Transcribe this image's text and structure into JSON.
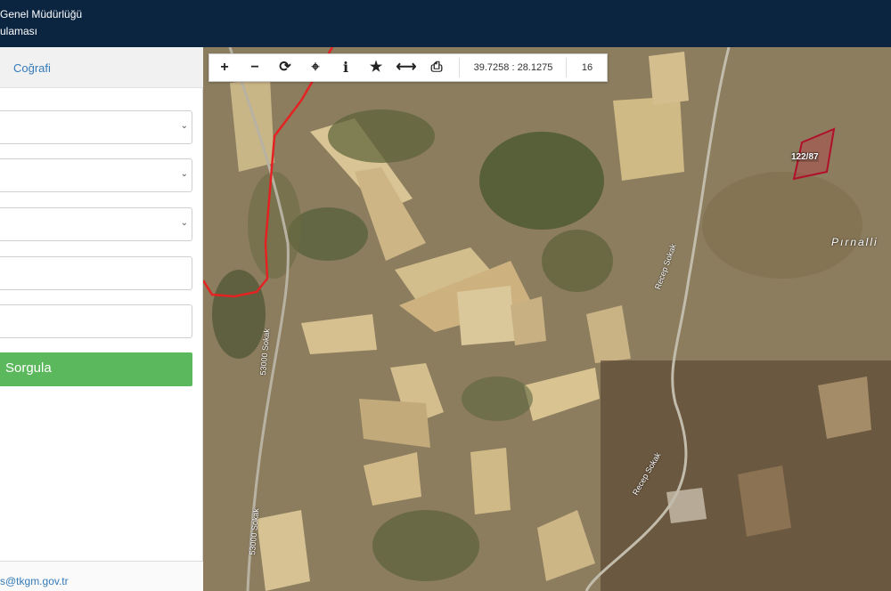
{
  "header": {
    "title_line1": "Genel Müdürlüğü",
    "title_line2": "ulaması"
  },
  "sidebar": {
    "tab_label": "Coğrafi",
    "query_button": "Sorgula",
    "footer_email": "s@tkgm.gov.tr"
  },
  "toolbar": {
    "zoom_in": "+",
    "zoom_out": "−",
    "refresh": "⟳",
    "locate": "⌖",
    "info": "i",
    "favorite": "★",
    "measure": "⟷",
    "print": "⎙",
    "coordinates": "39.7258 : 28.1275",
    "zoom_level": "16"
  },
  "map": {
    "parcel_label": "122/87",
    "place_name": "Pırnalli",
    "road_label_1": "Recep Sokak",
    "road_label_2": "53000 Sokak",
    "road_label_3": "Recep Sokak",
    "road_label_4": "53000 Sokak"
  }
}
